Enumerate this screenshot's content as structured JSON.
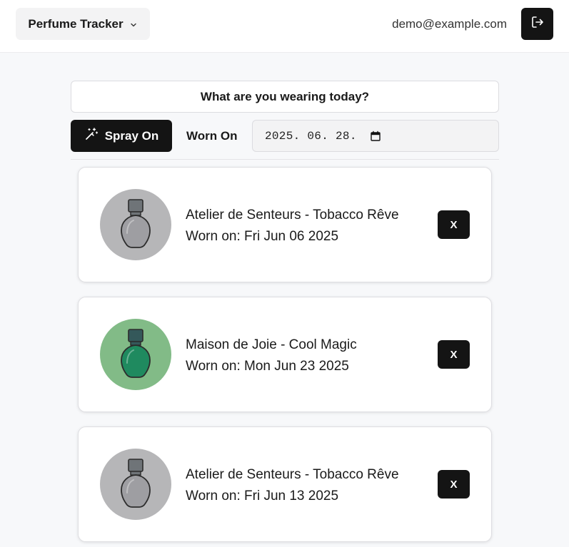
{
  "header": {
    "app_title": "Perfume Tracker",
    "user_email": "demo@example.com",
    "icons": {
      "menu": "chevron-down-icon",
      "logout": "logout-icon"
    }
  },
  "prompt": {
    "question": "What are you wearing today?"
  },
  "controls": {
    "spray_label": "Spray On",
    "spray_icon": "magic-wand-icon",
    "worn_on_label": "Worn On",
    "date_value": "2025. 06. 28.",
    "date_icon": "calendar-icon"
  },
  "entries": [
    {
      "name": "Atelier de Senteurs - Tobacco Rêve",
      "worn": "Worn on: Fri Jun 06 2025",
      "remove_label": "X",
      "bottle_color": "#9e9ea2",
      "cap_color": "#6f7478",
      "bg_color": "#b6b6b8"
    },
    {
      "name": "Maison de Joie - Cool Magic",
      "worn": "Worn on: Mon Jun 23 2025",
      "remove_label": "X",
      "bottle_color": "#1f8a5f",
      "cap_color": "#34585a",
      "bg_color": "#82bb87"
    },
    {
      "name": "Atelier de Senteurs - Tobacco Rêve",
      "worn": "Worn on: Fri Jun 13 2025",
      "remove_label": "X",
      "bottle_color": "#9e9ea2",
      "cap_color": "#6f7478",
      "bg_color": "#b6b6b8"
    }
  ],
  "colors": {
    "primary": "#141414",
    "page_bg": "#f7f8fa"
  }
}
